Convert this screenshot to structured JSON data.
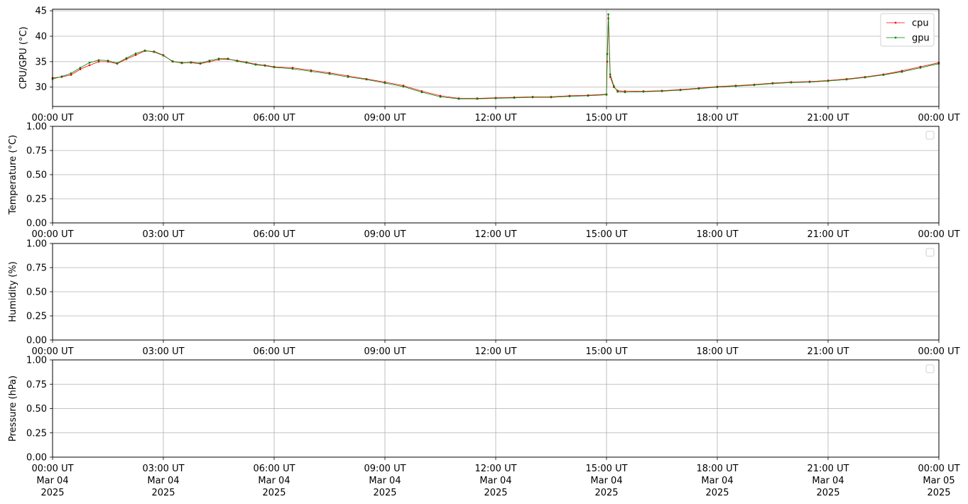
{
  "x_tick_labels": [
    "00:00 UT",
    "03:00 UT",
    "06:00 UT",
    "09:00 UT",
    "12:00 UT",
    "15:00 UT",
    "18:00 UT",
    "21:00 UT",
    "00:00 UT"
  ],
  "x_tick_dates": [
    {
      "line2": "Mar 04",
      "line3": "2025"
    },
    {
      "line2": "Mar 04",
      "line3": "2025"
    },
    {
      "line2": "Mar 04",
      "line3": "2025"
    },
    {
      "line2": "Mar 04",
      "line3": "2025"
    },
    {
      "line2": "Mar 04",
      "line3": "2025"
    },
    {
      "line2": "Mar 04",
      "line3": "2025"
    },
    {
      "line2": "Mar 04",
      "line3": "2025"
    },
    {
      "line2": "Mar 04",
      "line3": "2025"
    },
    {
      "line2": "Mar 05",
      "line3": "2025"
    }
  ],
  "chart_data": [
    {
      "type": "line",
      "ylabel": "CPU/GPU (°C)",
      "xlim": [
        "2025-03-04 00:00",
        "2025-03-05 00:00"
      ],
      "ylim": [
        26.2,
        45.3
      ],
      "yticks": [
        30,
        35,
        40,
        45
      ],
      "grid": true,
      "legend": "top-right",
      "x_unit_note": "hours UT",
      "x": [
        0.0,
        0.25,
        0.5,
        0.75,
        1.0,
        1.25,
        1.5,
        1.75,
        2.0,
        2.25,
        2.5,
        2.75,
        3.0,
        3.25,
        3.5,
        3.75,
        4.0,
        4.25,
        4.5,
        4.75,
        5.0,
        5.25,
        5.5,
        5.75,
        6.0,
        6.5,
        7.0,
        7.5,
        8.0,
        8.5,
        9.0,
        9.5,
        10.0,
        10.5,
        11.0,
        11.5,
        12.0,
        12.5,
        13.0,
        13.5,
        14.0,
        14.5,
        15.0,
        15.02,
        15.05,
        15.1,
        15.2,
        15.3,
        15.5,
        16.0,
        16.5,
        17.0,
        17.5,
        18.0,
        18.5,
        19.0,
        19.5,
        20.0,
        20.5,
        21.0,
        21.5,
        22.0,
        22.5,
        23.0,
        23.5,
        24.0
      ],
      "series": [
        {
          "name": "cpu",
          "color": "#ff0000",
          "values": [
            31.8,
            32.0,
            32.4,
            33.5,
            34.3,
            35.0,
            35.0,
            34.6,
            35.5,
            36.3,
            37.1,
            37.0,
            36.3,
            35.0,
            34.8,
            34.8,
            34.6,
            35.0,
            35.4,
            35.5,
            35.2,
            34.9,
            34.5,
            34.3,
            34.0,
            33.8,
            33.3,
            32.8,
            32.2,
            31.6,
            31.0,
            30.3,
            29.2,
            28.3,
            27.8,
            27.8,
            27.9,
            28.0,
            28.1,
            28.1,
            28.3,
            28.4,
            28.6,
            35.0,
            43.5,
            32.0,
            30.0,
            29.3,
            29.2,
            29.2,
            29.3,
            29.5,
            29.8,
            30.1,
            30.3,
            30.5,
            30.8,
            31.0,
            31.1,
            31.3,
            31.6,
            32.0,
            32.5,
            33.2,
            34.0,
            34.8
          ]
        },
        {
          "name": "gpu",
          "color": "#008000",
          "values": [
            31.6,
            32.1,
            32.7,
            33.8,
            34.8,
            35.3,
            35.2,
            34.7,
            35.7,
            36.6,
            37.2,
            36.9,
            36.2,
            35.1,
            34.7,
            34.9,
            34.7,
            35.2,
            35.6,
            35.6,
            35.1,
            34.8,
            34.4,
            34.2,
            33.9,
            33.6,
            33.1,
            32.6,
            32.0,
            31.5,
            30.8,
            30.1,
            29.0,
            28.1,
            27.7,
            27.7,
            27.8,
            27.9,
            28.0,
            28.0,
            28.2,
            28.3,
            28.5,
            36.5,
            44.3,
            32.5,
            30.2,
            29.1,
            29.0,
            29.1,
            29.2,
            29.4,
            29.7,
            30.0,
            30.2,
            30.4,
            30.7,
            30.9,
            31.0,
            31.2,
            31.5,
            31.9,
            32.4,
            33.0,
            33.8,
            34.6
          ]
        }
      ]
    },
    {
      "type": "line",
      "ylabel": "Temperature (°C)",
      "xlim": [
        "2025-03-04 00:00",
        "2025-03-05 00:00"
      ],
      "ylim": [
        0,
        1
      ],
      "yticks": [
        "0.00",
        "0.25",
        "0.50",
        "0.75",
        "1.00"
      ],
      "grid": true,
      "legend": "top-right (empty)",
      "series": []
    },
    {
      "type": "line",
      "ylabel": "Humidity (%)",
      "xlim": [
        "2025-03-04 00:00",
        "2025-03-05 00:00"
      ],
      "ylim": [
        0,
        1
      ],
      "yticks": [
        "0.00",
        "0.25",
        "0.50",
        "0.75",
        "1.00"
      ],
      "grid": true,
      "legend": "top-right (empty)",
      "series": []
    },
    {
      "type": "line",
      "ylabel": "Pressure (hPa)",
      "xlim": [
        "2025-03-04 00:00",
        "2025-03-05 00:00"
      ],
      "ylim": [
        0,
        1
      ],
      "yticks": [
        "0.00",
        "0.25",
        "0.50",
        "0.75",
        "1.00"
      ],
      "grid": true,
      "legend": "top-right (empty)",
      "series": []
    }
  ]
}
